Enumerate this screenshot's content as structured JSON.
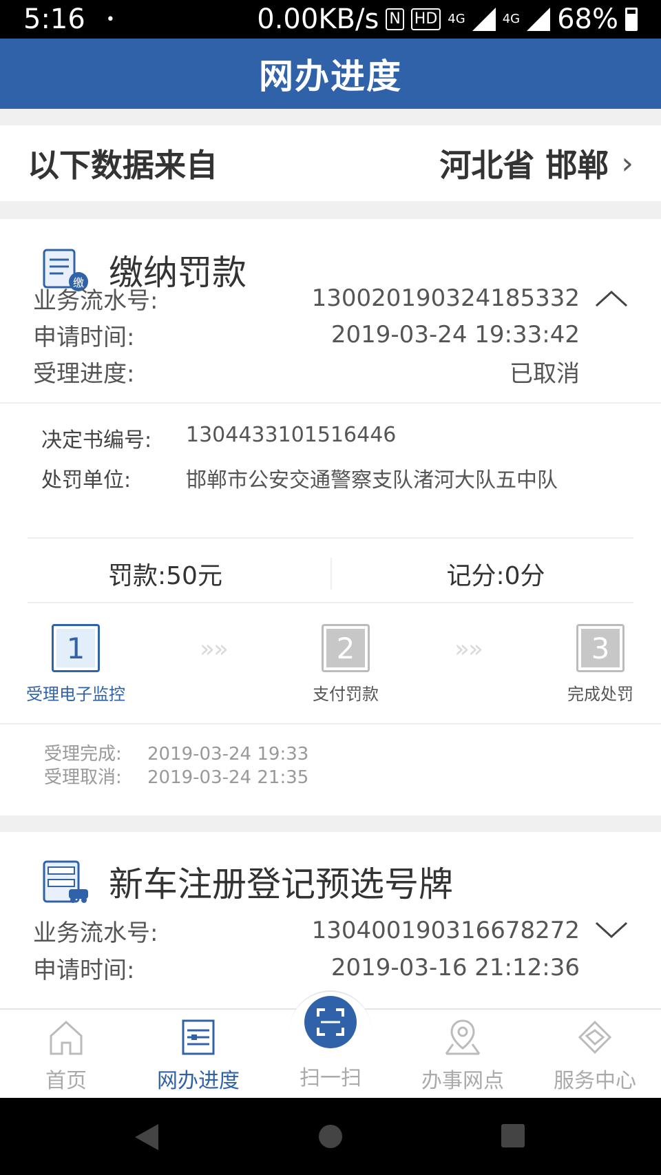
{
  "status_bar": {
    "time": "5:16",
    "dot": "•",
    "speed": "0.00KB/s",
    "nfc": "N",
    "hd": "HD",
    "net1": "4G",
    "net2": "4G",
    "battery": "68%"
  },
  "header": {
    "title": "网办进度"
  },
  "region": {
    "label": "以下数据来自",
    "value": "河北省 邯郸",
    "chevron": "›"
  },
  "card1": {
    "title": "缴纳罚款",
    "icon_badge": "缴",
    "serial_label": "业务流水号:",
    "serial_value": "130020190324185332",
    "apply_time_label": "申请时间:",
    "apply_time_value": "2019-03-24 19:33:42",
    "progress_label": "受理进度:",
    "progress_value": "已取消",
    "decision_label": "决定书编号:",
    "decision_value": "1304433101516446",
    "unit_label": "处罚单位:",
    "unit_value": "邯郸市公安交通警察支队渚河大队五中队",
    "fine": "罚款:50元",
    "points": "记分:0分",
    "steps": [
      {
        "num": "1",
        "label": "受理电子监控"
      },
      {
        "num": "2",
        "label": "支付罚款"
      },
      {
        "num": "3",
        "label": "完成处罚"
      }
    ],
    "arrows": "»»",
    "timeline": [
      {
        "label": "受理完成:",
        "value": "2019-03-24 19:33"
      },
      {
        "label": "受理取消:",
        "value": "2019-03-24 21:35"
      }
    ]
  },
  "card2": {
    "title": "新车注册登记预选号牌",
    "serial_label": "业务流水号:",
    "serial_value": "130400190316678272",
    "apply_time_label": "申请时间:",
    "apply_time_value": "2019-03-16 21:12:36"
  },
  "bottom_nav": [
    {
      "label": "首页",
      "icon": "home-icon"
    },
    {
      "label": "网办进度",
      "icon": "progress-icon"
    },
    {
      "label": "扫一扫",
      "icon": "scan-icon"
    },
    {
      "label": "办事网点",
      "icon": "location-icon"
    },
    {
      "label": "服务中心",
      "icon": "handshake-icon"
    }
  ],
  "colors": {
    "primary": "#2f62a8",
    "background": "#f0f0f0"
  }
}
